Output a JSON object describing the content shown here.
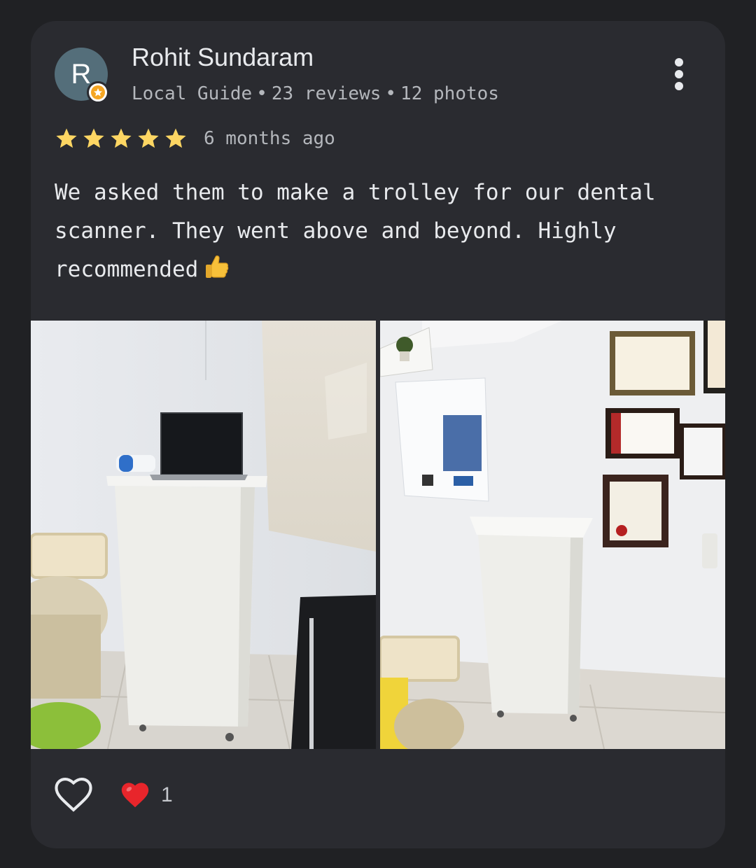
{
  "reviewer": {
    "avatar_initial": "R",
    "name": "Rohit Sundaram",
    "badge": "Local Guide",
    "reviews": "23 reviews",
    "photos": "12 photos",
    "separator": "•"
  },
  "rating": {
    "stars": 5,
    "max_stars": 5,
    "time": "6 months ago",
    "star_color": "#fdd663"
  },
  "review": {
    "text": "We asked them to make a trolley for our dental scanner. They went above and beyond. Highly recommended"
  },
  "photos": [
    {
      "name": "trolley-with-laptop-photo"
    },
    {
      "name": "trolley-in-clinic-photo"
    }
  ],
  "reactions": {
    "like_icon": "heart-outline-icon",
    "reaction_icon": "red-heart-icon",
    "count": "1",
    "heart_color": "#e8252b"
  },
  "menu_icon": "more-vert-icon",
  "colors": {
    "background": "#202124",
    "card": "#2a2b30",
    "text_primary": "#e8eaed",
    "text_secondary": "#b4b7bc",
    "avatar": "#546e7a",
    "guide_badge": "#f5a623"
  }
}
